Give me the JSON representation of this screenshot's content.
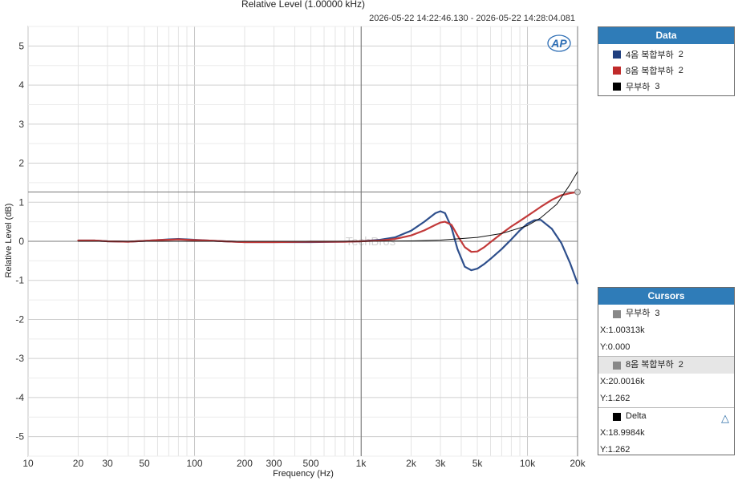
{
  "title": "Relative Level (1.00000 kHz)",
  "subtitle": "2026-05-22 14:22:46.130 - 2026-05-22 14:28:04.081",
  "logo_text": "AP",
  "watermark": "TechBros",
  "colors": {
    "s1": "#2e4f8c",
    "s2": "#c23a3a",
    "s3": "#111111",
    "panel_header": "#2f7cb8"
  },
  "chart_data": {
    "type": "line",
    "title": "Relative Level (1.00000 kHz)",
    "xlabel": "Frequency (Hz)",
    "ylabel": "Relative Level (dB)",
    "xscale": "log",
    "xlim": [
      10,
      20000
    ],
    "ylim": [
      -5.5,
      5.5
    ],
    "x_ticks": [
      10,
      20,
      30,
      50,
      100,
      200,
      300,
      500,
      1000,
      2000,
      3000,
      5000,
      10000,
      20000
    ],
    "x_tick_labels": [
      "10",
      "20",
      "30",
      "50",
      "100",
      "200",
      "300",
      "500",
      "1k",
      "2k",
      "3k",
      "5k",
      "10k",
      "20k"
    ],
    "y_ticks": [
      -5,
      -4,
      -3,
      -2,
      -1,
      0,
      1,
      2,
      3,
      4,
      5
    ],
    "y_tick_labels": [
      "-5",
      "-4",
      "-3",
      "-2",
      "-1",
      "0",
      "1",
      "2",
      "3",
      "4",
      "5"
    ],
    "grid": true,
    "cursor_lines": {
      "x": [
        1003.13,
        20001.6
      ],
      "y": [
        0.0,
        1.262
      ]
    },
    "cursor_marker": {
      "x": 20001.6,
      "y": 1.262
    },
    "series": [
      {
        "name": "4옴 복합부하",
        "index": "2",
        "color": "#2e4f8c",
        "x": [
          20,
          25,
          30,
          40,
          50,
          60,
          70,
          80,
          90,
          100,
          120,
          150,
          200,
          300,
          500,
          800,
          1000,
          1300,
          1600,
          2000,
          2400,
          2800,
          3000,
          3200,
          3500,
          3800,
          4200,
          4600,
          5000,
          5500,
          6000,
          7000,
          8000,
          9000,
          10000,
          11000,
          12000,
          14000,
          16000,
          18000,
          20000
        ],
        "y": [
          0.02,
          0.02,
          0.0,
          -0.01,
          0.01,
          0.03,
          0.05,
          0.06,
          0.05,
          0.04,
          0.02,
          0.0,
          -0.02,
          -0.02,
          -0.02,
          -0.01,
          0.0,
          0.04,
          0.1,
          0.27,
          0.5,
          0.72,
          0.77,
          0.72,
          0.35,
          -0.2,
          -0.65,
          -0.74,
          -0.7,
          -0.58,
          -0.45,
          -0.2,
          0.05,
          0.28,
          0.45,
          0.54,
          0.55,
          0.32,
          -0.05,
          -0.55,
          -1.08
        ]
      },
      {
        "name": "8옴 복합부하",
        "index": "2",
        "color": "#c23a3a",
        "x": [
          20,
          25,
          30,
          40,
          50,
          60,
          70,
          80,
          90,
          100,
          120,
          150,
          200,
          300,
          500,
          800,
          1000,
          1300,
          1600,
          2000,
          2400,
          2800,
          3000,
          3200,
          3500,
          3800,
          4200,
          4600,
          5000,
          5500,
          6000,
          7000,
          8000,
          9000,
          10000,
          11000,
          12000,
          14000,
          16000,
          18000,
          20000
        ],
        "y": [
          0.02,
          0.02,
          0.0,
          -0.01,
          0.01,
          0.03,
          0.04,
          0.05,
          0.04,
          0.03,
          0.02,
          0.0,
          -0.02,
          -0.02,
          -0.01,
          -0.01,
          0.0,
          0.02,
          0.06,
          0.15,
          0.28,
          0.42,
          0.48,
          0.5,
          0.42,
          0.15,
          -0.15,
          -0.27,
          -0.26,
          -0.15,
          -0.02,
          0.2,
          0.38,
          0.52,
          0.65,
          0.77,
          0.88,
          1.06,
          1.18,
          1.23,
          1.262
        ]
      },
      {
        "name": "무부하",
        "index": "3",
        "color": "#111111",
        "x": [
          20,
          30,
          50,
          100,
          200,
          500,
          1000,
          2000,
          3000,
          5000,
          7000,
          10000,
          12000,
          15000,
          18000,
          20000
        ],
        "y": [
          0.0,
          0.0,
          0.0,
          0.0,
          0.0,
          0.0,
          0.0,
          0.01,
          0.03,
          0.1,
          0.2,
          0.4,
          0.6,
          0.95,
          1.45,
          1.78
        ]
      }
    ]
  },
  "data_panel": {
    "header": "Data",
    "items": [
      {
        "label": "4옴 복합부하",
        "index": "2",
        "color": "#1f3f7f"
      },
      {
        "label": "8옴 복합부하",
        "index": "2",
        "color": "#c02a2a"
      },
      {
        "label": "무부하",
        "index": "3",
        "color": "#000000"
      }
    ]
  },
  "cursors_panel": {
    "header": "Cursors",
    "c1": {
      "label": "무부하",
      "index": "3",
      "x": "X:1.00313k",
      "y": "Y:0.000"
    },
    "c2": {
      "label": "8옴 복합부하",
      "index": "2",
      "x": "X:20.0016k",
      "y": "Y:1.262"
    },
    "delta": {
      "label": "Delta",
      "x": "X:18.9984k",
      "y": "Y:1.262"
    }
  }
}
